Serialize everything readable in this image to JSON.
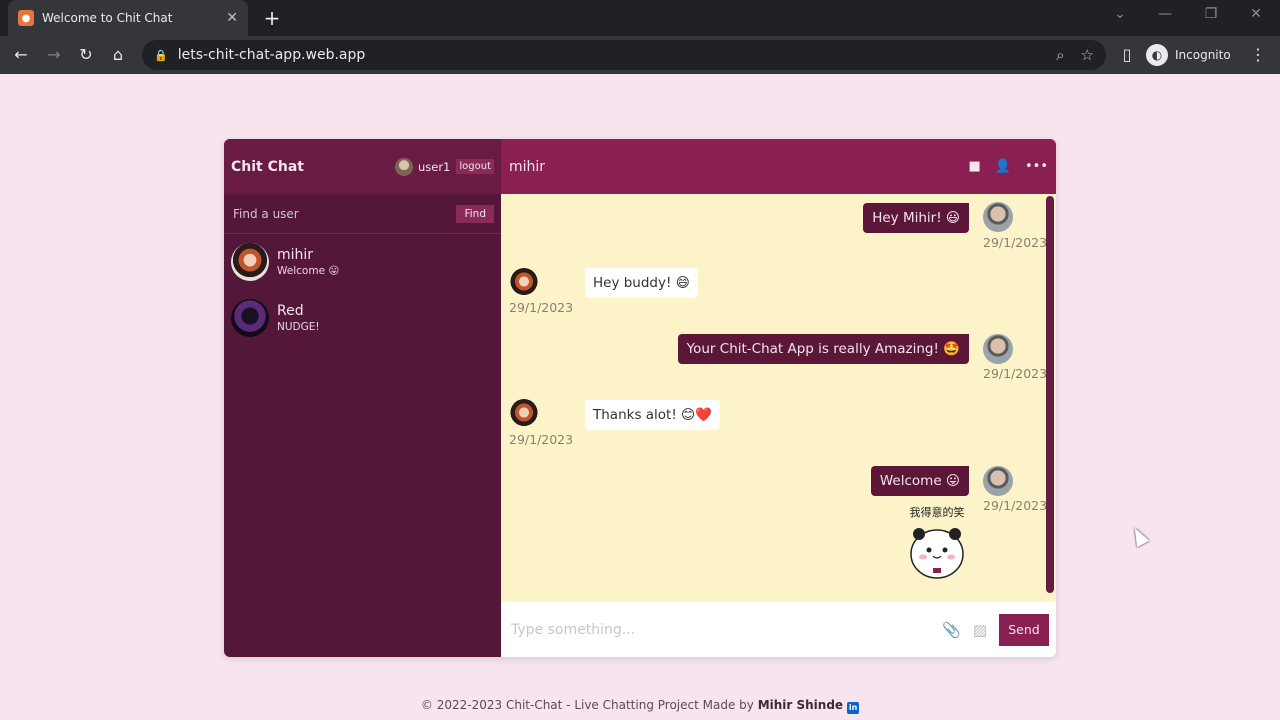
{
  "browser": {
    "tab_title": "Welcome to Chit Chat",
    "url": "lets-chit-chat-app.web.app",
    "profile_label": "Incognito"
  },
  "app": {
    "brand": "Chit Chat",
    "current_user": "user1",
    "logout_label": "logout",
    "search_placeholder": "Find a user",
    "find_label": "Find",
    "chats": [
      {
        "name": "mihir",
        "last_message": "Welcome 😛"
      },
      {
        "name": "Red",
        "last_message": "NUDGE!"
      }
    ],
    "active_chat_title": "mihir",
    "messages": [
      {
        "text": "Hey Mihir! 😃",
        "time": "29/1/2023",
        "own": true
      },
      {
        "text": "Hey buddy! 😄",
        "time": "29/1/2023",
        "own": false
      },
      {
        "text": "Your Chit-Chat App is really Amazing! 🤩",
        "time": "29/1/2023",
        "own": true
      },
      {
        "text": "Thanks alot! 😊❤️",
        "time": "29/1/2023",
        "own": false
      },
      {
        "text": "Welcome 😛",
        "time": "29/1/2023",
        "own": true
      }
    ],
    "sticker_caption": "我得意的笑",
    "input_placeholder": "Type something...",
    "send_label": "Send"
  },
  "footer": {
    "text": "© 2022-2023 Chit-Chat - Live Chatting Project Made by ",
    "author": "Mihir Shinde"
  },
  "colors": {
    "page_bg": "#f7e4ee",
    "sidebar_bg": "#54173a",
    "header_bg": "#8a1f52",
    "chat_bg": "#fdf3c9",
    "own_bubble": "#5c1637"
  }
}
